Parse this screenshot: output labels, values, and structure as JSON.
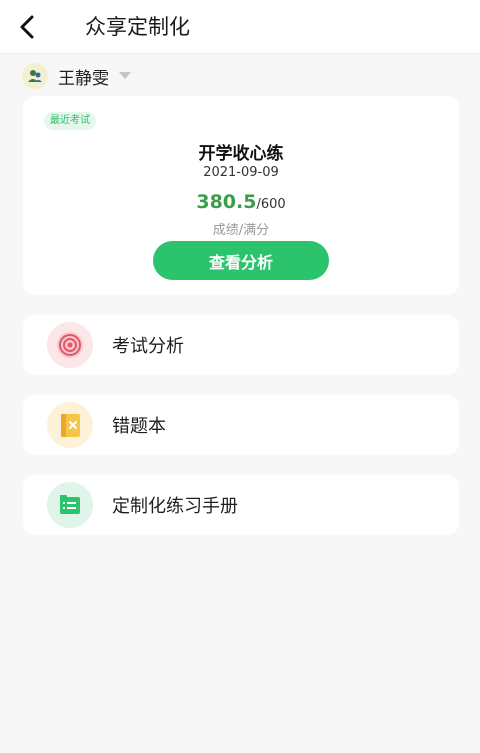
{
  "header": {
    "title": "众享定制化",
    "back_icon": "chevron-left-icon"
  },
  "user": {
    "name": "王静雯",
    "avatar_icon": "avatar-icon",
    "caret_icon": "caret-down-icon"
  },
  "recent_exam": {
    "badge": "最近考试",
    "title": "开学收心练",
    "date": "2021-09-09",
    "score": "380.5",
    "full_score": "/600",
    "score_label": "成绩/满分",
    "button_label": "查看分析"
  },
  "menu": {
    "items": [
      {
        "label": "考试分析",
        "icon": "target-icon",
        "icon_bg": "#fbe6e8",
        "icon_color": "#e0566a"
      },
      {
        "label": "错题本",
        "icon": "notebook-icon",
        "icon_bg": "#fdf1d8",
        "icon_color": "#f0b93a"
      },
      {
        "label": "定制化练习手册",
        "icon": "book-icon",
        "icon_bg": "#dff5e9",
        "icon_color": "#2cc36d"
      }
    ]
  },
  "colors": {
    "accent": "#2cc36d",
    "score": "#3a9d4c",
    "background": "#f7f7f7"
  }
}
